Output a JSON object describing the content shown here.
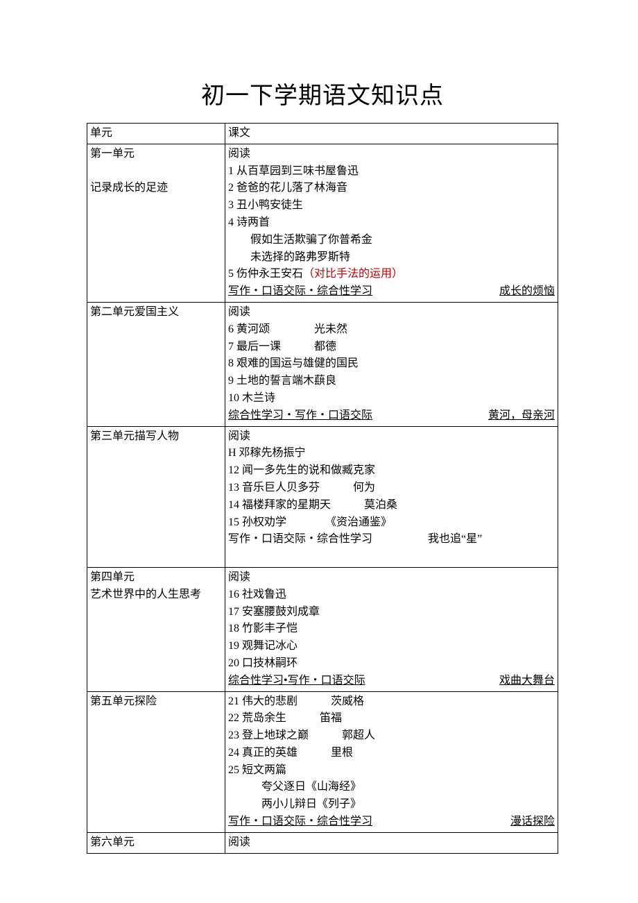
{
  "title": "初一下学期语文知识点",
  "header": {
    "unit": "单元",
    "text": "课文"
  },
  "units": [
    {
      "unit_lines": [
        "第一单元",
        "",
        "记录成长的足迹"
      ],
      "content_lines": [
        {
          "text": "阅读"
        },
        {
          "text": "1 从百草园到三味书屋鲁迅"
        },
        {
          "text": "2 爸爸的花儿落了林海音"
        },
        {
          "text": "3 丑小鸭安徒生"
        },
        {
          "text": "4 诗两首"
        },
        {
          "text": "　　假如生活欺骗了你普希金"
        },
        {
          "text": "　　未选择的路弗罗斯特"
        },
        {
          "text": "5 伤仲永王安石",
          "trailing_red": "（对比手法的运用）"
        },
        {
          "footer": true,
          "left": "写作・口语交际・综合性学习",
          "right": "成长的烦恼"
        }
      ]
    },
    {
      "unit_lines": [
        "第二单元爱国主义"
      ],
      "content_lines": [
        {
          "text": "阅读"
        },
        {
          "text": "6 黄河颂　　　　光未然"
        },
        {
          "text": "7 最后一课　　　都德"
        },
        {
          "text": "8 艰难的国运与雄健的国民"
        },
        {
          "text": "9 土地的誓言端木蕻良"
        },
        {
          "text": "10 木兰诗"
        },
        {
          "footer": true,
          "left": "综合性学习・写作・口语交际",
          "right": "黄河，母亲河"
        }
      ]
    },
    {
      "unit_lines": [
        "第三单元描写人物"
      ],
      "content_lines": [
        {
          "text": "阅读"
        },
        {
          "text": "H 邓稼先杨振宁"
        },
        {
          "text": "12 闻一多先生的说和做臧克家"
        },
        {
          "text": "13 音乐巨人贝多芬　　　何为"
        },
        {
          "text": "14 福楼拜家的星期天　　　莫泊桑"
        },
        {
          "text": "15 孙权劝学　　　　《资治通鉴》"
        },
        {
          "text": "写作・口语交际・综合性学习　　　　　我也追“星”"
        },
        {
          "text": "　"
        }
      ]
    },
    {
      "unit_lines": [
        "第四单元",
        "艺术世界中的人生思考"
      ],
      "content_lines": [
        {
          "text": "阅读"
        },
        {
          "text": "16 社戏鲁迅"
        },
        {
          "text": "17 安塞腰鼓刘成章"
        },
        {
          "text": "18 竹影丰子恺"
        },
        {
          "text": "19 观舞记冰心"
        },
        {
          "text": "20 口技林嗣环"
        },
        {
          "footer": true,
          "left": "综合性学习•写作・口语交际",
          "right": "戏曲大舞台"
        }
      ]
    },
    {
      "unit_lines": [
        "第五单元探险"
      ],
      "content_lines": [
        {
          "text": "21 伟大的悲剧　　　茨威格"
        },
        {
          "text": "22 荒岛余生　　　笛福"
        },
        {
          "text": "23 登上地球之巅　　　郭超人"
        },
        {
          "text": "24 真正的英雄　　　里根"
        },
        {
          "text": "25 短文两篇"
        },
        {
          "text": "　　　夸父逐日《山海经》"
        },
        {
          "text": "　　　两小儿辩日《列子》"
        },
        {
          "footer": true,
          "left": "写作・口语交际・综合性学习",
          "right": "漫话探险"
        }
      ]
    },
    {
      "unit_lines": [
        "第六单元"
      ],
      "content_lines": [
        {
          "text": "阅读"
        }
      ]
    }
  ]
}
